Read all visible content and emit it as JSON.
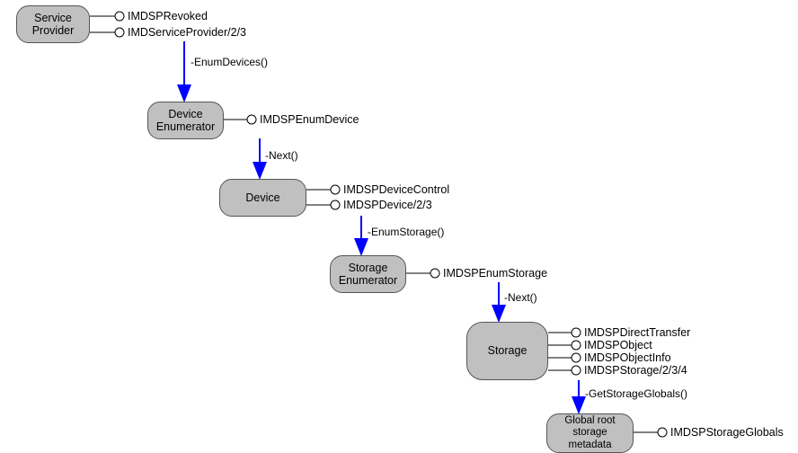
{
  "nodes": {
    "serviceProvider": "Service\nProvider",
    "deviceEnumerator": "Device\nEnumerator",
    "device": "Device",
    "storageEnumerator": "Storage\nEnumerator",
    "storage": "Storage",
    "globalRoot": "Global root\nstorage\nmetadata"
  },
  "interfaces": {
    "sp1": "IMDSPRevoked",
    "sp2": "IMDServiceProvider/2/3",
    "de1": "IMDSPEnumDevice",
    "dv1": "IMDSPDeviceControl",
    "dv2": "IMDSPDevice/2/3",
    "se1": "IMDSPEnumStorage",
    "st1": "IMDSPDirectTransfer",
    "st2": "IMDSPObject",
    "st3": "IMDSPObjectInfo",
    "st4": "IMDSPStorage/2/3/4",
    "gr1": "IMDSPStorageGlobals"
  },
  "calls": {
    "enumDevices": "-EnumDevices()",
    "next1": "-Next()",
    "enumStorage": "-EnumStorage()",
    "next2": "-Next()",
    "getStorageGlobals": "-GetStorageGlobals()"
  }
}
